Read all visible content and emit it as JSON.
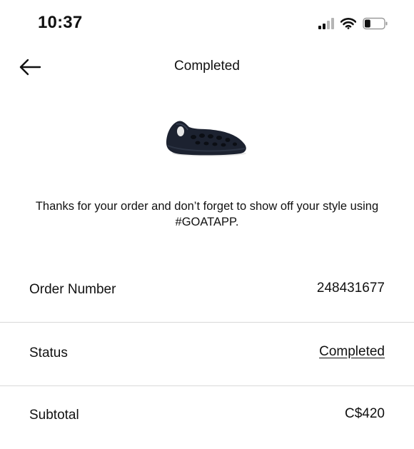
{
  "status_bar": {
    "time": "10:37",
    "signal_icon": "cellular-signal-icon",
    "wifi_icon": "wifi-icon",
    "battery_icon": "battery-icon",
    "battery_level": 0.3
  },
  "header": {
    "back_icon": "arrow-left-icon",
    "title": "Completed"
  },
  "product": {
    "image_icon": "foam-runner-shoe-image"
  },
  "message": {
    "text": "Thanks for your order and don’t forget to show off your style using #GOATAPP."
  },
  "details": [
    {
      "label": "Order Number",
      "value": "248431677"
    },
    {
      "label": "Status",
      "value": "Completed"
    },
    {
      "label": "Subtotal",
      "value": "C$420"
    }
  ],
  "colors": {
    "text": "#111111",
    "divider": "#d9d9d9",
    "background": "#ffffff"
  }
}
